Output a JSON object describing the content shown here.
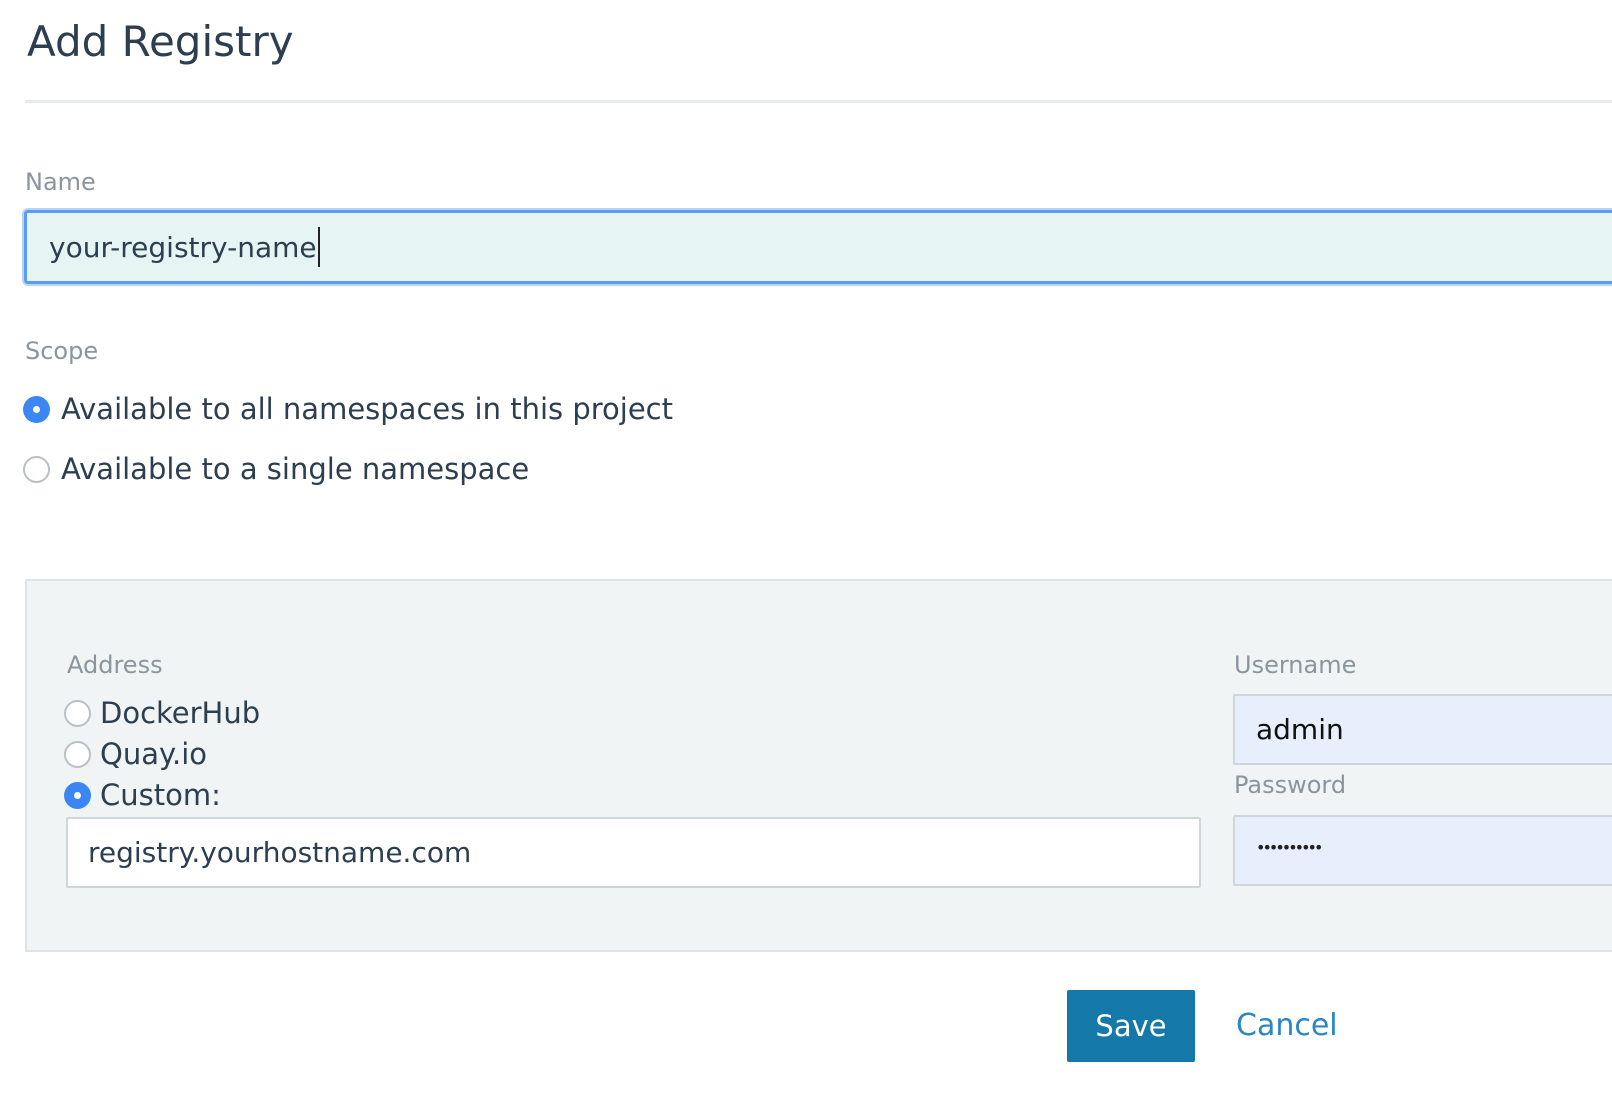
{
  "page": {
    "title": "Add Registry"
  },
  "name_field": {
    "label": "Name",
    "value": "your-registry-name"
  },
  "scope": {
    "label": "Scope",
    "options": [
      {
        "label": "Available to all namespaces in this project",
        "checked": true
      },
      {
        "label": "Available to a single namespace",
        "checked": false
      }
    ]
  },
  "address": {
    "label": "Address",
    "options": [
      {
        "label": "DockerHub",
        "checked": false
      },
      {
        "label": "Quay.io",
        "checked": false
      },
      {
        "label": "Custom:",
        "checked": true
      }
    ],
    "custom_value": "registry.yourhostname.com"
  },
  "credentials": {
    "username_label": "Username",
    "username_value": "admin",
    "password_label": "Password",
    "password_mask": "••••••••••"
  },
  "actions": {
    "save_label": "Save",
    "cancel_label": "Cancel"
  },
  "colors": {
    "primary": "#1478a8",
    "radio_checked": "#3b86f2",
    "link": "#2b86c4",
    "focus": "#5b9bf0"
  }
}
